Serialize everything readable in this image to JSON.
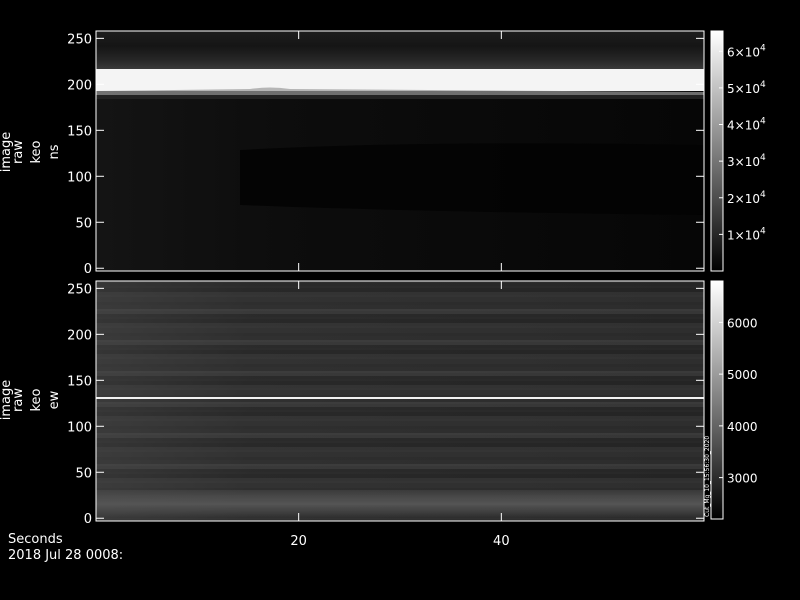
{
  "chart_data": [
    {
      "type": "heatmap",
      "ylabel_lines": [
        "image",
        "raw",
        "keo",
        "ns"
      ],
      "y_tick_labels": [
        "0",
        "50",
        "100",
        "150",
        "200",
        "250"
      ],
      "y_ticks": [
        0,
        50,
        100,
        150,
        200,
        250
      ],
      "ylim": [
        -3,
        258
      ],
      "colorbar": {
        "ticks": [
          10000,
          20000,
          30000,
          40000,
          50000,
          60000
        ],
        "tick_labels": [
          {
            "mant": "1×10",
            "exp": "4"
          },
          {
            "mant": "2×10",
            "exp": "4"
          },
          {
            "mant": "3×10",
            "exp": "4"
          },
          {
            "mant": "4×10",
            "exp": "4"
          },
          {
            "mant": "5×10",
            "exp": "4"
          },
          {
            "mant": "6×10",
            "exp": "4"
          }
        ],
        "range": [
          0,
          65535
        ]
      }
    },
    {
      "type": "heatmap",
      "ylabel_lines": [
        "image",
        "raw",
        "keo",
        "ew"
      ],
      "y_tick_labels": [
        "0",
        "50",
        "100",
        "150",
        "200",
        "250"
      ],
      "y_ticks": [
        0,
        50,
        100,
        150,
        200,
        250
      ],
      "ylim": [
        -3,
        258
      ],
      "colorbar": {
        "ticks": [
          3000,
          4000,
          5000,
          6000
        ],
        "tick_labels": [
          "3000",
          "4000",
          "5000",
          "6000"
        ],
        "range": [
          2200,
          6800
        ],
        "side_text": "Cut_Mg_10_15:56:30_2020"
      }
    }
  ],
  "x_axis": {
    "xlabel": "Seconds",
    "ticks": [
      20,
      40
    ],
    "tick_labels": [
      "20",
      "40"
    ],
    "xlim": [
      0,
      60
    ]
  },
  "date_label": "2018 Jul 28 0008:"
}
